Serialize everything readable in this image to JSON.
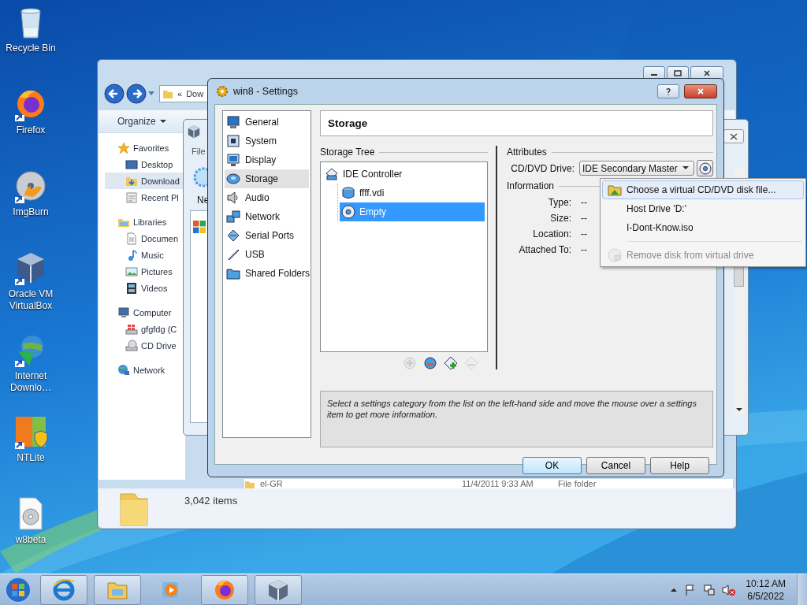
{
  "desktop_icons": [
    {
      "label": "Recycle Bin",
      "kind": "recycle"
    },
    {
      "label": "Firefox",
      "kind": "firefox"
    },
    {
      "label": "ImgBurn",
      "kind": "imgburn"
    },
    {
      "label": "Oracle VM VirtualBox",
      "kind": "vbox"
    },
    {
      "label": "Internet Downlo…",
      "kind": "idm"
    },
    {
      "label": "NTLite",
      "kind": "ntlite"
    },
    {
      "label": "w8beta",
      "kind": "discfile"
    }
  ],
  "explorer": {
    "address_chevron": "«",
    "address": "Dow",
    "organize": "Organize",
    "nav": [
      {
        "label": "Favorites",
        "kind": "star",
        "selected": false,
        "children": [
          {
            "label": "Desktop",
            "kind": "desktop",
            "selected": false
          },
          {
            "label": "Download",
            "kind": "dlfolder",
            "selected": true
          },
          {
            "label": "Recent Pl",
            "kind": "recent",
            "selected": false
          }
        ]
      },
      {
        "label": "Libraries",
        "kind": "libraries",
        "selected": false,
        "children": [
          {
            "label": "Documen",
            "kind": "document",
            "selected": false
          },
          {
            "label": "Music",
            "kind": "music",
            "selected": false
          },
          {
            "label": "Pictures",
            "kind": "pictures",
            "selected": false
          },
          {
            "label": "Videos",
            "kind": "videos",
            "selected": false
          }
        ]
      },
      {
        "label": "Computer",
        "kind": "computer",
        "selected": false,
        "children": [
          {
            "label": "gfgfdg (C",
            "kind": "drive",
            "selected": false
          },
          {
            "label": "CD Drive",
            "kind": "cddrive",
            "selected": false
          }
        ]
      },
      {
        "label": "Network",
        "kind": "globe",
        "selected": false
      }
    ],
    "file_row": {
      "name": "el-GR",
      "date": "11/4/2011 9:33 AM",
      "type": "File folder"
    },
    "status": "3,042 items"
  },
  "vbox_manager": {
    "menu": "File",
    "tool": "Ne"
  },
  "settings": {
    "title": "win8 - Settings",
    "categories": [
      {
        "label": "General",
        "kind": "monitor",
        "selected": false
      },
      {
        "label": "System",
        "kind": "chip",
        "selected": false
      },
      {
        "label": "Display",
        "kind": "display",
        "selected": false
      },
      {
        "label": "Storage",
        "kind": "disk",
        "selected": true
      },
      {
        "label": "Audio",
        "kind": "speaker",
        "selected": false
      },
      {
        "label": "Network",
        "kind": "network",
        "selected": false
      },
      {
        "label": "Serial Ports",
        "kind": "serial",
        "selected": false
      },
      {
        "label": "USB",
        "kind": "usb",
        "selected": false
      },
      {
        "label": "Shared Folders",
        "kind": "folder",
        "selected": false
      }
    ],
    "page_title": "Storage",
    "tree_label": "Storage Tree",
    "tree": [
      {
        "label": "IDE Controller",
        "kind": "controller",
        "selected": false,
        "children": [
          {
            "label": "ffff.vdi",
            "kind": "hdd",
            "selected": false
          },
          {
            "label": "Empty",
            "kind": "cd",
            "selected": true
          }
        ]
      }
    ],
    "tree_tools": [
      {
        "kind": "add-controller",
        "disabled": true
      },
      {
        "kind": "remove-controller",
        "disabled": false
      },
      {
        "kind": "add-attachment",
        "disabled": false
      },
      {
        "kind": "remove-attachment",
        "disabled": true
      }
    ],
    "attributes_label": "Attributes",
    "drive_label": "CD/DVD Drive:",
    "drive_value": "IDE Secondary Master",
    "information_label": "Information",
    "info": [
      {
        "label": "Type:",
        "value": "--"
      },
      {
        "label": "Size:",
        "value": "--"
      },
      {
        "label": "Location:",
        "value": "--"
      },
      {
        "label": "Attached To:",
        "value": "--"
      }
    ],
    "description": "Select a settings category from the list on the left-hand side and move the mouse over a settings item to get more information.",
    "buttons": [
      {
        "label": "OK",
        "default": true
      },
      {
        "label": "Cancel",
        "default": false
      },
      {
        "label": "Help",
        "default": false
      }
    ]
  },
  "drive_menu": [
    {
      "label": "Choose a virtual CD/DVD disk file...",
      "kind": "file",
      "selected": true,
      "disabled": false
    },
    {
      "label": "Host Drive 'D:'",
      "kind": "plain",
      "selected": false,
      "disabled": false
    },
    {
      "label": "I-Dont-Know.iso",
      "kind": "plain",
      "selected": false,
      "disabled": false
    },
    {
      "label": "Remove disk from virtual drive",
      "kind": "remove",
      "selected": false,
      "disabled": true
    }
  ],
  "taskbar": {
    "apps": [
      {
        "kind": "ie",
        "running": true
      },
      {
        "kind": "explorer",
        "running": true
      },
      {
        "kind": "media",
        "running": false
      },
      {
        "kind": "firefox",
        "running": true
      },
      {
        "kind": "vbox",
        "running": true
      }
    ],
    "time": "10:12 AM",
    "date": "6/5/2022"
  }
}
